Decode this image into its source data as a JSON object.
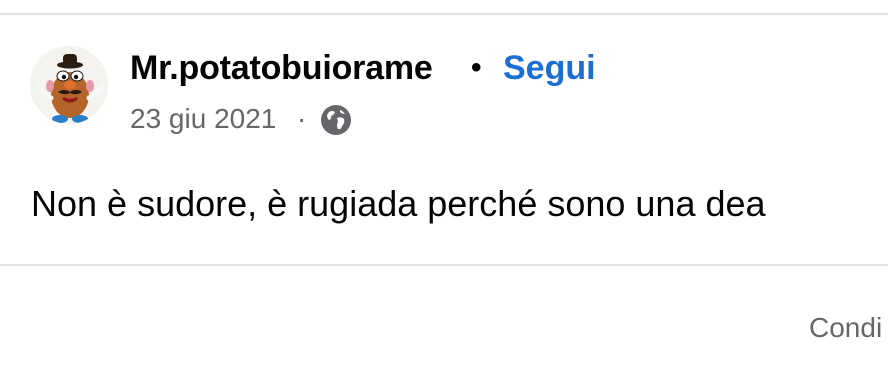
{
  "post": {
    "author": {
      "name": "Mr.potatobuiorame",
      "avatar_icon": "mr-potato-head-avatar"
    },
    "separator": "•",
    "follow_label": "Segui",
    "follow_color": "#1b6fd4",
    "date": "23 giu 2021",
    "meta_separator": "·",
    "audience_icon": "globe-icon",
    "text": "Non è sudore, è rugiada perché sono una dea"
  },
  "footer": {
    "conditions_label": "Condi"
  }
}
